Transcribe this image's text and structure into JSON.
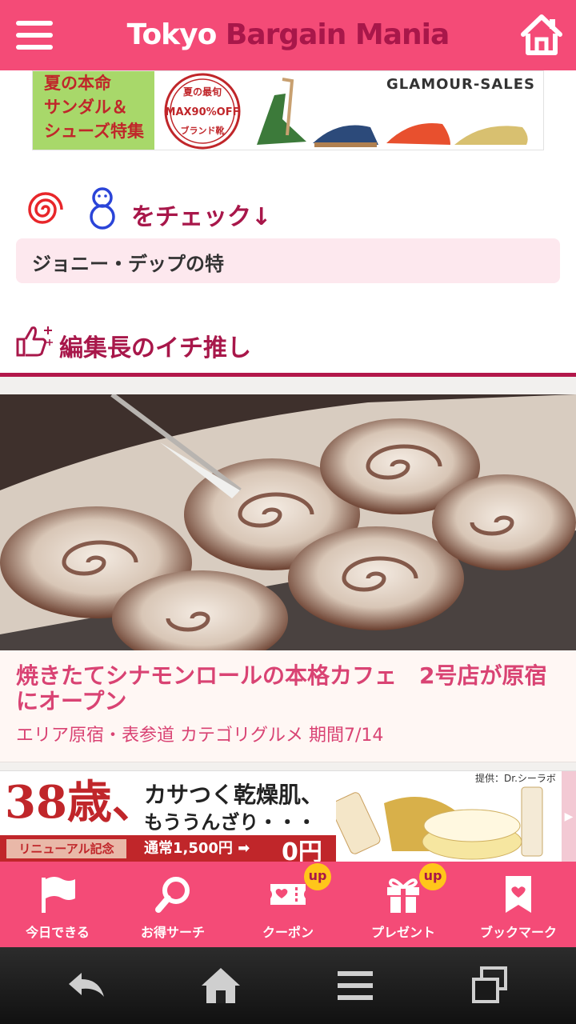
{
  "header": {
    "logo_part1": "Tokyo",
    "logo_part2": "Bargain Mania",
    "bg_color": "#f44b77",
    "menu_icon": "hamburger-menu-icon",
    "home_icon": "home-icon"
  },
  "top_banner": {
    "left_copy": [
      "夏の本命",
      "サンダル＆",
      "シューズ特集"
    ],
    "stamp_text": "MAX90%OFF",
    "stamp_top": "夏の最旬",
    "stamp_bottom": "ブランド靴",
    "brand": "GLAMOUR-SALES"
  },
  "check": {
    "label": "をチェック↓",
    "ticker": "ジョニー・デップの特"
  },
  "section": {
    "title": "編集長のイチ推し",
    "icon": "thumbs-up-icon"
  },
  "article": {
    "title": "焼きたてシナモンロールの本格カフェ　2号店が原宿にオープン",
    "meta": "エリア原宿・表参道 カテゴリグルメ 期間7/14"
  },
  "ad": {
    "age": "38歳、",
    "copy1": "カサつく乾燥肌、",
    "copy2": "もううんざり・・・",
    "provider": "提供：Dr.シーラボ",
    "renewal": "リニューアル記念",
    "price": "通常1,500円 ➡",
    "zero": "0円"
  },
  "tabs": [
    {
      "label": "今日できる",
      "icon": "flag-icon",
      "badge": ""
    },
    {
      "label": "お得サーチ",
      "icon": "search-icon",
      "badge": ""
    },
    {
      "label": "クーポン",
      "icon": "coupon-icon",
      "badge": "up"
    },
    {
      "label": "プレゼント",
      "icon": "gift-icon",
      "badge": "up"
    },
    {
      "label": "ブックマーク",
      "icon": "bookmark-icon",
      "badge": ""
    }
  ],
  "system_bar": {
    "buttons": [
      "back-icon",
      "home-icon",
      "menu-icon",
      "recent-apps-icon"
    ]
  }
}
